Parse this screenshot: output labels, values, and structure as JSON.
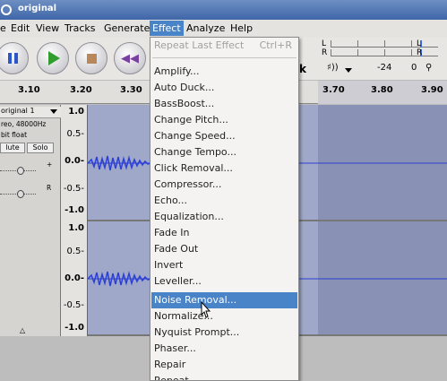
{
  "window": {
    "title": "original"
  },
  "menubar": {
    "items": [
      {
        "label": "e",
        "name": "menu-file"
      },
      {
        "label": "Edit",
        "name": "menu-edit"
      },
      {
        "label": "View",
        "name": "menu-view"
      },
      {
        "label": "Tracks",
        "name": "menu-tracks"
      },
      {
        "label": "Generate",
        "name": "menu-generate"
      },
      {
        "label": "Effect",
        "name": "menu-effect"
      },
      {
        "label": "Analyze",
        "name": "menu-analyze"
      },
      {
        "label": "Help",
        "name": "menu-help"
      }
    ]
  },
  "meter": {
    "left_label": "L",
    "right_label": "R",
    "right_l": "L",
    "right_r": "R",
    "k_label": "k",
    "db": "-24",
    "zero": "0"
  },
  "ruler": {
    "ticks": [
      "3.10",
      "3.20",
      "3.30",
      "3.70",
      "3.80",
      "3.90"
    ]
  },
  "track": {
    "name": "original 1",
    "info_line1": "reo, 48000Hz",
    "info_line2": "bit float",
    "mute": "lute",
    "solo": "Solo",
    "pan_plus": "+",
    "pan_r": "R",
    "collapse": "△"
  },
  "vruler": {
    "top": [
      "1.0",
      "0.5-",
      "0.0-",
      "-0.5-",
      "-1.0"
    ],
    "bottom": [
      "1.0",
      "0.5-",
      "0.0-",
      "-0.5-",
      "-1.0"
    ]
  },
  "effect_menu": {
    "repeat": {
      "label": "Repeat Last Effect",
      "shortcut": "Ctrl+R"
    },
    "items": [
      "Amplify...",
      "Auto Duck...",
      "BassBoost...",
      "Change Pitch...",
      "Change Speed...",
      "Change Tempo...",
      "Click Removal...",
      "Compressor...",
      "Echo...",
      "Equalization...",
      "Fade In",
      "Fade Out",
      "Invert",
      "Leveller...",
      "Noise Removal...",
      "Normalize...",
      "Nyquist Prompt...",
      "Phaser...",
      "Repair",
      "Repeat..."
    ],
    "highlighted": "Noise Removal..."
  },
  "colors": {
    "accent": "#4a84c8",
    "waveform": "#2c3fd4",
    "track_bg": "#9fa8c8"
  }
}
